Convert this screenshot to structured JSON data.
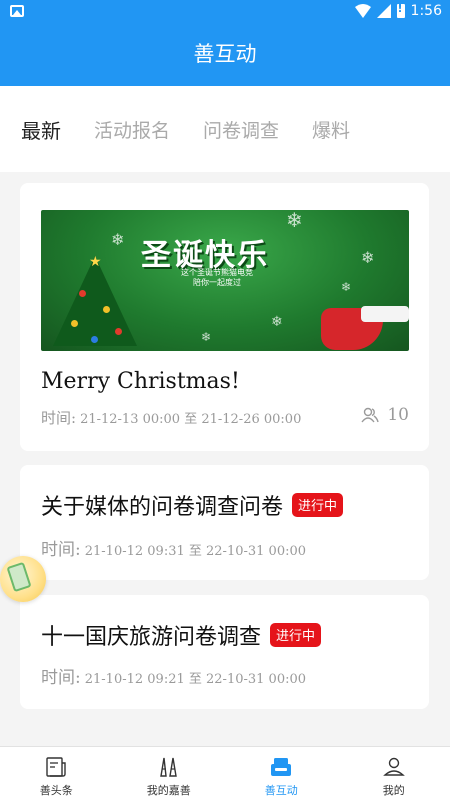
{
  "status_bar": {
    "time": "1:56",
    "icons": [
      "gallery-icon",
      "wifi-icon",
      "signal-icon",
      "battery-icon"
    ]
  },
  "header": {
    "title": "善互动",
    "background_color": "#2196f3"
  },
  "tabs": [
    {
      "label": "最新",
      "active": true
    },
    {
      "label": "活动报名",
      "active": false
    },
    {
      "label": "问卷调查",
      "active": false
    },
    {
      "label": "爆料",
      "active": false
    }
  ],
  "cards": [
    {
      "banner": {
        "title": "圣诞快乐",
        "subtitle_line1": "这个圣诞节熊猫电竞",
        "subtitle_line2": "陪你一起度过"
      },
      "title": "Merry Christmas!",
      "time_label": "时间:",
      "time_value": "21-12-13 00:00 至 21-12-26 00:00",
      "participants": "10"
    },
    {
      "title": "关于媒体的问卷调查问卷",
      "badge": "进行中",
      "time_label": "时间:",
      "time_value": "21-10-12 09:31 至 22-10-31 00:00"
    },
    {
      "title": "十一国庆旅游问卷调查",
      "badge": "进行中",
      "time_label": "时间:",
      "time_value": "21-10-12 09:21 至 22-10-31 00:00"
    }
  ],
  "badge_color": "#e5141a",
  "bottom_nav": [
    {
      "label": "善头条",
      "icon": "newspaper-icon",
      "active": false
    },
    {
      "label": "我的嘉善",
      "icon": "landmark-icon",
      "active": false
    },
    {
      "label": "善互动",
      "icon": "interaction-icon",
      "active": true
    },
    {
      "label": "我的",
      "icon": "user-icon",
      "active": false
    }
  ]
}
